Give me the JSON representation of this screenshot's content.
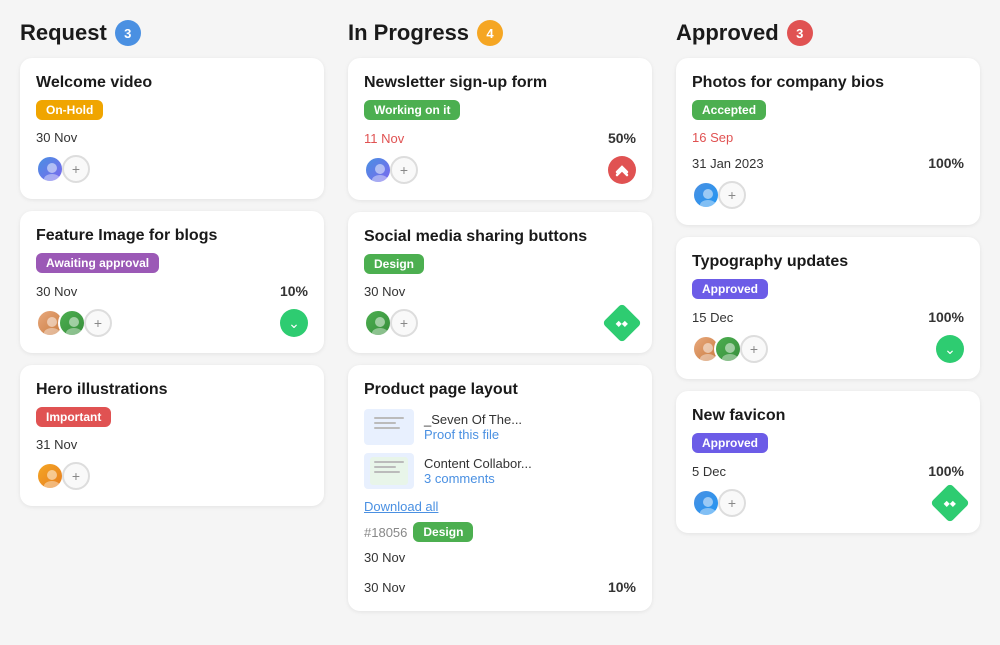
{
  "columns": [
    {
      "id": "request",
      "title": "Request",
      "badge": "3",
      "badge_color": "badge-blue",
      "cards": [
        {
          "id": "welcome-video",
          "title": "Welcome video",
          "tag": "On-Hold",
          "tag_class": "tag-onhold",
          "date": "30 Nov",
          "date_red": false,
          "avatars": [
            "av1"
          ],
          "show_plus": true,
          "progress": null,
          "icon": null
        },
        {
          "id": "feature-image",
          "title": "Feature Image for blogs",
          "tag": "Awaiting approval",
          "tag_class": "tag-awaiting",
          "date": "30 Nov",
          "date_red": false,
          "avatars": [
            "av2",
            "av3"
          ],
          "show_plus": true,
          "progress": "10%",
          "icon": "chevron-down"
        },
        {
          "id": "hero-illustrations",
          "title": "Hero illustrations",
          "tag": "Important",
          "tag_class": "tag-important",
          "date": "31 Nov",
          "date_red": false,
          "avatars": [
            "av5"
          ],
          "show_plus": true,
          "progress": null,
          "icon": null
        }
      ]
    },
    {
      "id": "in-progress",
      "title": "In Progress",
      "badge": "4",
      "badge_color": "badge-yellow",
      "cards": [
        {
          "id": "newsletter-form",
          "title": "Newsletter sign-up form",
          "tag": "Working on it",
          "tag_class": "tag-working",
          "date": "11 Nov",
          "date_red": true,
          "avatars": [
            "av1"
          ],
          "show_plus": true,
          "progress": "50%",
          "icon": "up-red",
          "has_files": false
        },
        {
          "id": "social-media",
          "title": "Social media sharing buttons",
          "tag": "Design",
          "tag_class": "tag-design",
          "date": "30 Nov",
          "date_red": false,
          "avatars": [
            "av3"
          ],
          "show_plus": true,
          "progress": null,
          "icon": "diamond-green",
          "has_files": false
        },
        {
          "id": "product-page",
          "title": "Product page layout",
          "tag": null,
          "tag_class": null,
          "date": "30 Nov",
          "date_red": false,
          "avatars": [],
          "show_plus": false,
          "progress": "10%",
          "icon": null,
          "has_files": true,
          "files": [
            {
              "name": "_Seven Of The...",
              "action": "Proof this file",
              "thumb_color": "#e8f0fe"
            },
            {
              "name": "Content Collabor...",
              "action": "3 comments",
              "thumb_color": "#e8f5e9"
            }
          ],
          "download_label": "Download all",
          "ticket_id": "#18056",
          "ticket_tag": "Design"
        }
      ]
    },
    {
      "id": "approved",
      "title": "Approved",
      "badge": "3",
      "badge_color": "badge-red",
      "cards": [
        {
          "id": "photos-bios",
          "title": "Photos for company bios",
          "tag": "Accepted",
          "tag_class": "tag-accepted",
          "date": "16 Sep",
          "date_red": true,
          "date2": "31 Jan 2023",
          "avatars": [
            "av6"
          ],
          "show_plus": true,
          "progress": "100%",
          "icon": null
        },
        {
          "id": "typography-updates",
          "title": "Typography updates",
          "tag": "Approved",
          "tag_class": "tag-approved",
          "date": "15 Dec",
          "date_red": false,
          "avatars": [
            "av2",
            "av3"
          ],
          "show_plus": true,
          "progress": "100%",
          "icon": "chevron-down"
        },
        {
          "id": "new-favicon",
          "title": "New favicon",
          "tag": "Approved",
          "tag_class": "tag-approved",
          "date": "5 Dec",
          "date_red": false,
          "avatars": [
            "av6"
          ],
          "show_plus": true,
          "progress": "100%",
          "icon": "diamond-green"
        }
      ]
    }
  ]
}
